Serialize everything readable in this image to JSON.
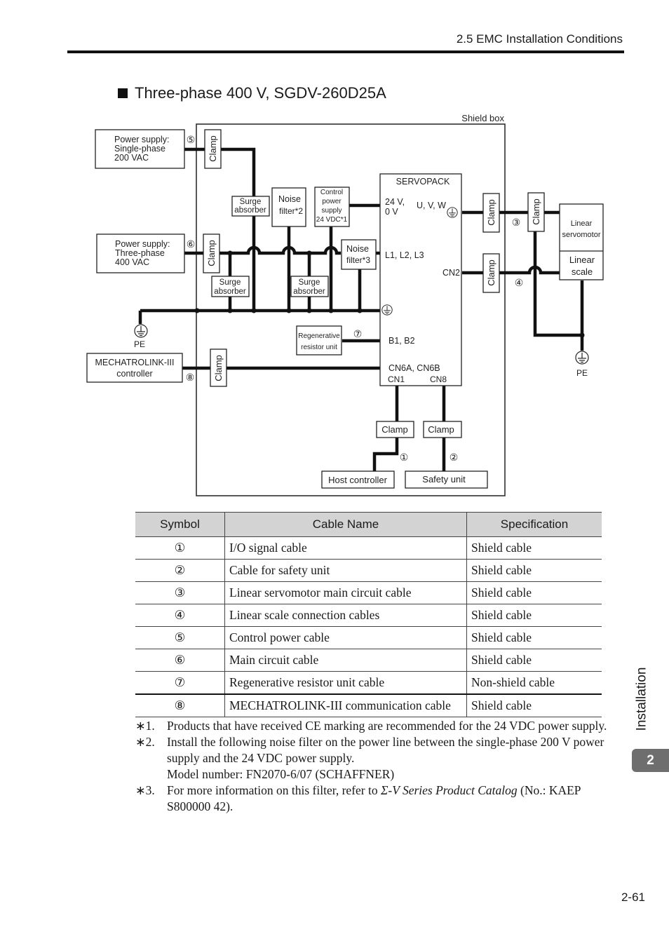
{
  "header": {
    "section": "2.5  EMC Installation Conditions"
  },
  "title": "Three-phase 400 V, SGDV-260D25A",
  "diagram": {
    "shield_box_label": "Shield box",
    "power_supply_single": [
      "Power supply:",
      "Single-phase",
      "200 VAC"
    ],
    "power_supply_three": [
      "Power supply:",
      "Three-phase",
      "400 VAC"
    ],
    "clamp_label": "Clamp",
    "surge_absorber": [
      "Surge",
      "absorber"
    ],
    "noise_filter_2": [
      "Noise",
      "filter*2"
    ],
    "noise_filter_3": [
      "Noise",
      "filter*3"
    ],
    "control_power_supply": [
      "Control",
      "power",
      "supply",
      "24 VDC*1"
    ],
    "servopack": "SERVOPACK",
    "terminal_24v": [
      "24 V,",
      "0 V"
    ],
    "terminal_uvw": "U, V, W",
    "terminal_l123": "L1, L2, L3",
    "terminal_cn2": "CN2",
    "terminal_b1b2": "B1, B2",
    "terminal_cn6": "CN6A, CN6B",
    "terminal_cn1": "CN1",
    "terminal_cn8": "CN8",
    "regen_unit": [
      "Regenerative",
      "resistor unit"
    ],
    "mechatrolink": [
      "MECHATROLINK-III",
      "controller"
    ],
    "linear_servomotor": [
      "Linear",
      "servomotor"
    ],
    "linear_scale": [
      "Linear",
      "scale"
    ],
    "pe": "PE",
    "host_controller": "Host controller",
    "safety_unit": "Safety unit",
    "markers": [
      "①",
      "②",
      "③",
      "④",
      "⑤",
      "⑥",
      "⑦",
      "⑧"
    ]
  },
  "table": {
    "headers": [
      "Symbol",
      "Cable Name",
      "Specification"
    ],
    "rows": [
      {
        "symbol": "①",
        "name": "I/O signal cable",
        "spec": "Shield cable"
      },
      {
        "symbol": "②",
        "name": "Cable for safety unit",
        "spec": "Shield cable"
      },
      {
        "symbol": "③",
        "name": "Linear servomotor main circuit cable",
        "spec": "Shield cable"
      },
      {
        "symbol": "④",
        "name": "Linear scale connection cables",
        "spec": "Shield cable"
      },
      {
        "symbol": "⑤",
        "name": "Control power cable",
        "spec": "Shield cable"
      },
      {
        "symbol": "⑥",
        "name": "Main circuit cable",
        "spec": "Shield cable"
      },
      {
        "symbol": "⑦",
        "name": "Regenerative resistor unit cable",
        "spec": "Non-shield cable"
      },
      {
        "symbol": "⑧",
        "name": "MECHATROLINK-III communication cable",
        "spec": "Shield cable"
      }
    ]
  },
  "notes": [
    {
      "mark": "∗1.",
      "lines": [
        "Products that have received CE marking are recommended for the 24 VDC power supply."
      ]
    },
    {
      "mark": "∗2.",
      "lines": [
        "Install the following noise filter on the power line between the single-phase 200 V power supply and the 24 VDC power supply.",
        "Model number: FN2070-6/07 (SCHAFFNER)"
      ]
    },
    {
      "mark": "∗3.",
      "pre": "For more information on this filter, refer to ",
      "italic": "Σ-V Series Product Catalog",
      "post": " (No.: KAEP S800000 42)."
    }
  ],
  "side_tab": {
    "label": "Installation",
    "chapter": "2"
  },
  "page_number": "2-61"
}
